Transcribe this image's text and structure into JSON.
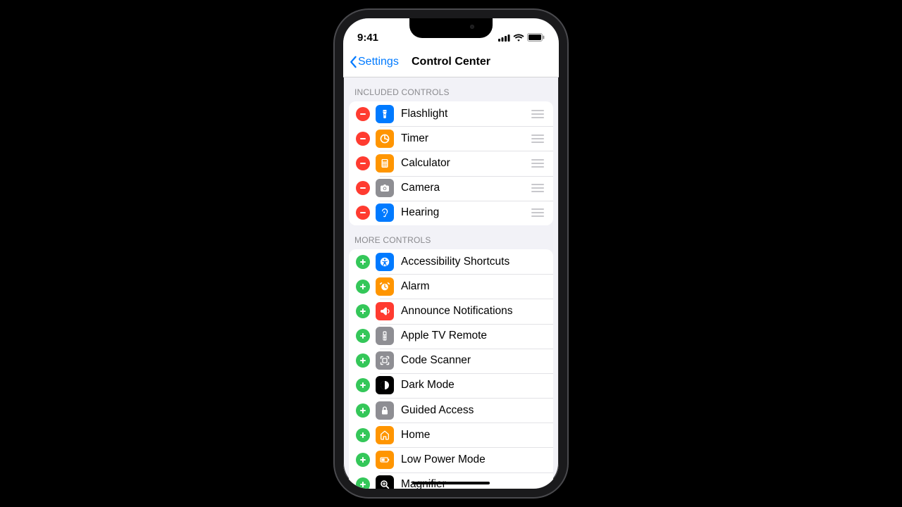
{
  "status": {
    "time": "9:41"
  },
  "nav": {
    "back": "Settings",
    "title": "Control Center"
  },
  "sections": {
    "included": {
      "header": "INCLUDED CONTROLS",
      "items": [
        {
          "label": "Flashlight",
          "icon": "flashlight",
          "color": "#007aff"
        },
        {
          "label": "Timer",
          "icon": "timer",
          "color": "#ff9500"
        },
        {
          "label": "Calculator",
          "icon": "calculator",
          "color": "#ff9500"
        },
        {
          "label": "Camera",
          "icon": "camera",
          "color": "#8e8e93"
        },
        {
          "label": "Hearing",
          "icon": "ear",
          "color": "#007aff"
        }
      ]
    },
    "more": {
      "header": "MORE CONTROLS",
      "items": [
        {
          "label": "Accessibility Shortcuts",
          "icon": "accessibility",
          "color": "#007aff"
        },
        {
          "label": "Alarm",
          "icon": "alarm",
          "color": "#ff9500"
        },
        {
          "label": "Announce Notifications",
          "icon": "announce",
          "color": "#ff3b30"
        },
        {
          "label": "Apple TV Remote",
          "icon": "remote",
          "color": "#8e8e93"
        },
        {
          "label": "Code Scanner",
          "icon": "scanner",
          "color": "#8e8e93"
        },
        {
          "label": "Dark Mode",
          "icon": "darkmode",
          "color": "#000000"
        },
        {
          "label": "Guided Access",
          "icon": "lock",
          "color": "#8e8e93"
        },
        {
          "label": "Home",
          "icon": "home",
          "color": "#ff9500"
        },
        {
          "label": "Low Power Mode",
          "icon": "battery",
          "color": "#ff9500"
        },
        {
          "label": "Magnifier",
          "icon": "magnifier",
          "color": "#000000"
        }
      ]
    }
  }
}
